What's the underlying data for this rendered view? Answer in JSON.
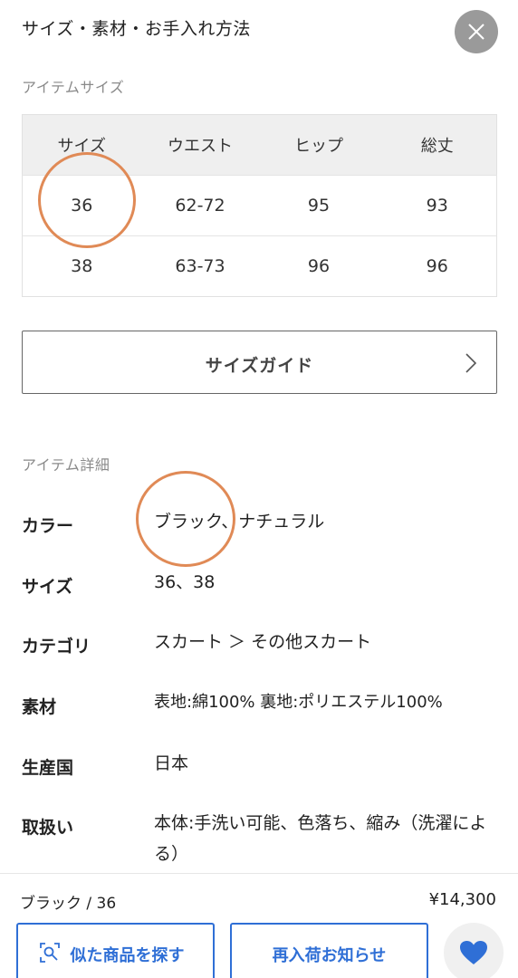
{
  "header": {
    "title": "サイズ・素材・お手入れ方法"
  },
  "size_section": {
    "label": "アイテムサイズ",
    "columns": [
      "サイズ",
      "ウエスト",
      "ヒップ",
      "総丈"
    ],
    "rows": [
      [
        "36",
        "62-72",
        "95",
        "93"
      ],
      [
        "38",
        "63-73",
        "96",
        "96"
      ]
    ],
    "guide_label": "サイズガイド"
  },
  "detail_section": {
    "label": "アイテム詳細",
    "rows": [
      {
        "key": "カラー",
        "value": "ブラック、ナチュラル"
      },
      {
        "key": "サイズ",
        "value": "36、38"
      },
      {
        "key": "カテゴリ",
        "value": "スカート ＞ その他スカート"
      },
      {
        "key": "素材",
        "value": "表地:綿100% 裏地:ポリエステル100%"
      },
      {
        "key": "生産国",
        "value": "日本"
      },
      {
        "key": "取扱い",
        "value": "本体:手洗い可能、色落ち、縮み（洗濯による）"
      }
    ]
  },
  "bottom": {
    "selected_variant": "ブラック / 36",
    "price": "¥14,300",
    "similar_label": "似た商品を探す",
    "restock_label": "再入荷お知らせ"
  },
  "colors": {
    "accent": "#2f6fd6",
    "annotation": "#e08a56",
    "close_bg": "#9a9a9a"
  },
  "icons": {
    "close": "close-icon",
    "chevron": "chevron-right-icon",
    "similar": "image-search-icon",
    "favorite": "heart-icon"
  }
}
